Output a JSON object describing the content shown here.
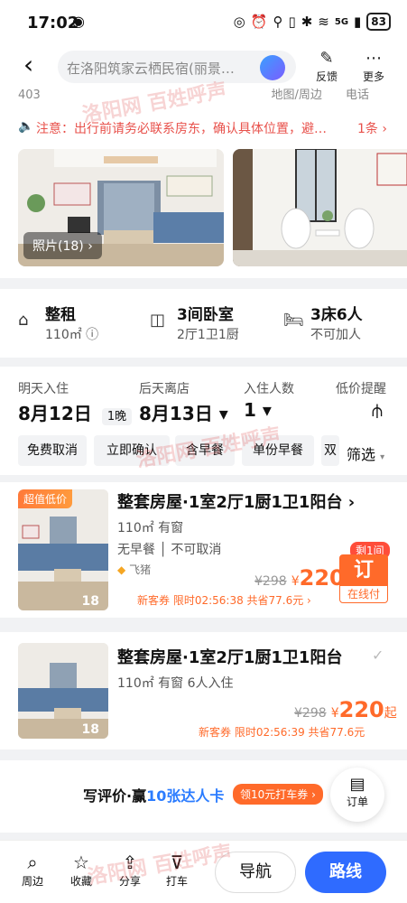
{
  "status": {
    "time": "17:02",
    "battery": "83",
    "network": "5G"
  },
  "header": {
    "search_text": "在洛阳筑家云栖民宿(丽景…",
    "feedback": "反馈",
    "more": "更多"
  },
  "sub": {
    "number": "403",
    "links": "地图/周边 电话"
  },
  "notice": {
    "text": "注意：出行前请务必联系房东，确认具体位置，避…",
    "count": "1条"
  },
  "gallery": {
    "photo_label": "照片(18)"
  },
  "specs": [
    {
      "title": "整租",
      "sub": "110㎡",
      "icon": "home-icon"
    },
    {
      "title": "3间卧室",
      "sub": "2厅1卫1厨",
      "icon": "door-icon"
    },
    {
      "title": "3床6人",
      "sub": "不可加人",
      "icon": "bed-icon"
    }
  ],
  "dates": {
    "checkin_label": "明天入住",
    "checkin": "8月12日",
    "nights": "1晚",
    "checkout_label": "后天离店",
    "checkout": "8月13日",
    "guests_label": "入住人数",
    "guests": "1",
    "alert_label": "低价提醒"
  },
  "filters": [
    "免费取消",
    "立即确认",
    "含早餐",
    "单份早餐",
    "双"
  ],
  "filter_button": "筛选",
  "rooms": [
    {
      "tag": "超值低价",
      "title": "整套房屋·1室2厅1厨1卫1阳台",
      "info1": "110㎡ 有窗",
      "info2": "无早餐 │ 不可取消",
      "platform": "飞猪",
      "old_price": "¥298",
      "price": "220",
      "remain": "剩1间",
      "book": "订",
      "book_sub": "在线付",
      "coupon": "新客券 限时02:56:38 共省77.6元 ›",
      "img_count": "18"
    },
    {
      "title": "整套房屋·1室2厅1厨1卫1阳台",
      "info1": "110㎡ 有窗 6人入住",
      "old_price": "¥298",
      "price": "220",
      "price_suffix": "起",
      "coupon": "新客券 限时02:56:39 共省77.6元",
      "img_count": "18"
    }
  ],
  "review": {
    "text_prefix": "写评价·赢",
    "text_highlight": "10张达人卡",
    "badge": "领10元打车券 ›",
    "order": "订单"
  },
  "bottom": {
    "around": "周边",
    "favorite": "收藏",
    "share": "分享",
    "taxi": "打车",
    "nav": "导航",
    "route": "路线"
  },
  "watermark": "洛阳网 百姓呼声",
  "colors": {
    "accent": "#ff6a2a",
    "notice": "#e8514b",
    "route_button": "#2f6bff",
    "highlight": "#2b7cff"
  }
}
